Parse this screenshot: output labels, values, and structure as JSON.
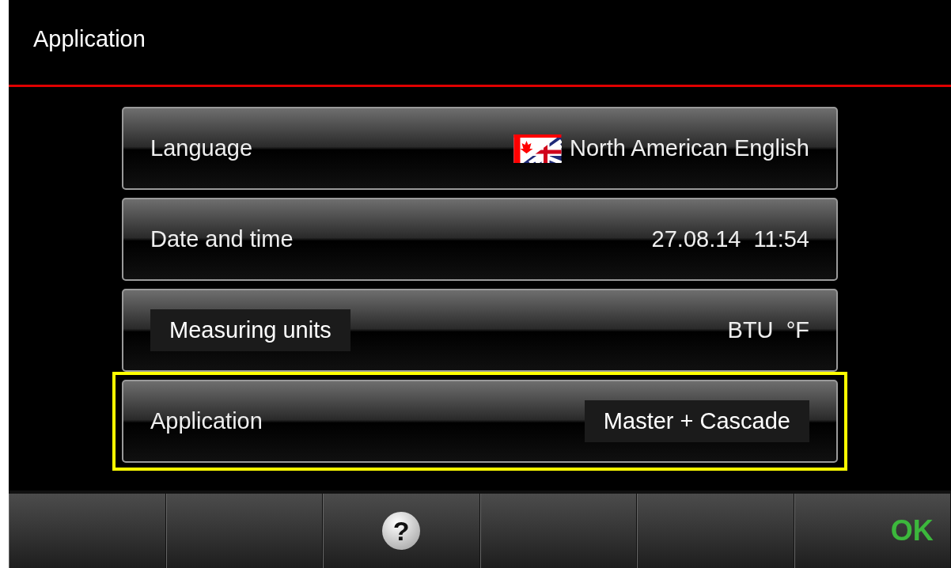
{
  "header": {
    "title": "Application"
  },
  "rows": [
    {
      "kind": "flag",
      "label": "Language",
      "value": "North American English",
      "highlighted": false
    },
    {
      "kind": "plain",
      "label": "Date and time",
      "value": "27.08.14  11:54",
      "highlighted": false
    },
    {
      "kind": "plain",
      "label_callout": "Measuring units",
      "value": "BTU  °F",
      "highlighted": false
    },
    {
      "kind": "plain",
      "label": "Application",
      "value_callout": "Master + Cascade",
      "highlighted": true
    }
  ],
  "bottom_bar": [
    {
      "kind": "blank"
    },
    {
      "kind": "blank"
    },
    {
      "kind": "help",
      "label": "?"
    },
    {
      "kind": "blank"
    },
    {
      "kind": "blank"
    },
    {
      "kind": "ok",
      "label": "OK"
    }
  ]
}
